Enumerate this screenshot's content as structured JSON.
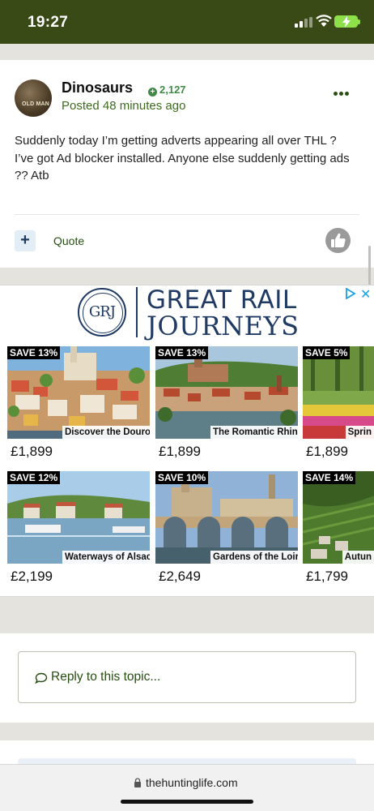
{
  "status": {
    "time": "19:27"
  },
  "post": {
    "author": "Dinosaurs",
    "reputation": "2,127",
    "posted": "Posted 48 minutes ago",
    "body": "Suddenly today I’m getting adverts appearing all over THL ? I’ve got Ad blocker installed. Anyone else suddenly getting ads ?? Atb",
    "avatar_text": "OLD MAN",
    "quote_label": "Quote",
    "plus_label": "+"
  },
  "ad": {
    "logo_initials": "GRJ",
    "brand_line1": "GREAT RAIL",
    "brand_line2": "JOURNEYS",
    "close_label": "✕",
    "tiles": [
      {
        "badge": "SAVE 13%",
        "caption": "Discover the Douro",
        "price": "£1,899",
        "scene": "town"
      },
      {
        "badge": "SAVE 13%",
        "caption": "The Romantic Rhin…",
        "price": "£1,899",
        "scene": "castle"
      },
      {
        "badge": "SAVE 5%",
        "caption": "Sprin",
        "price": "£1,899",
        "scene": "tulips"
      },
      {
        "badge": "SAVE 12%",
        "caption": "Waterways of Alsac…",
        "price": "£2,199",
        "scene": "river"
      },
      {
        "badge": "SAVE 10%",
        "caption": "Gardens of the Loir…",
        "price": "£2,649",
        "scene": "bridge"
      },
      {
        "badge": "SAVE 14%",
        "caption": "Autun",
        "price": "£1,799",
        "scene": "vineyard"
      }
    ]
  },
  "reply": {
    "placeholder": "Reply to this topic..."
  },
  "browser": {
    "url": "thehuntinglife.com"
  },
  "colors": {
    "header_green": "#3a4a16",
    "link_green": "#264d10",
    "brand_navy": "#1f3a63"
  }
}
